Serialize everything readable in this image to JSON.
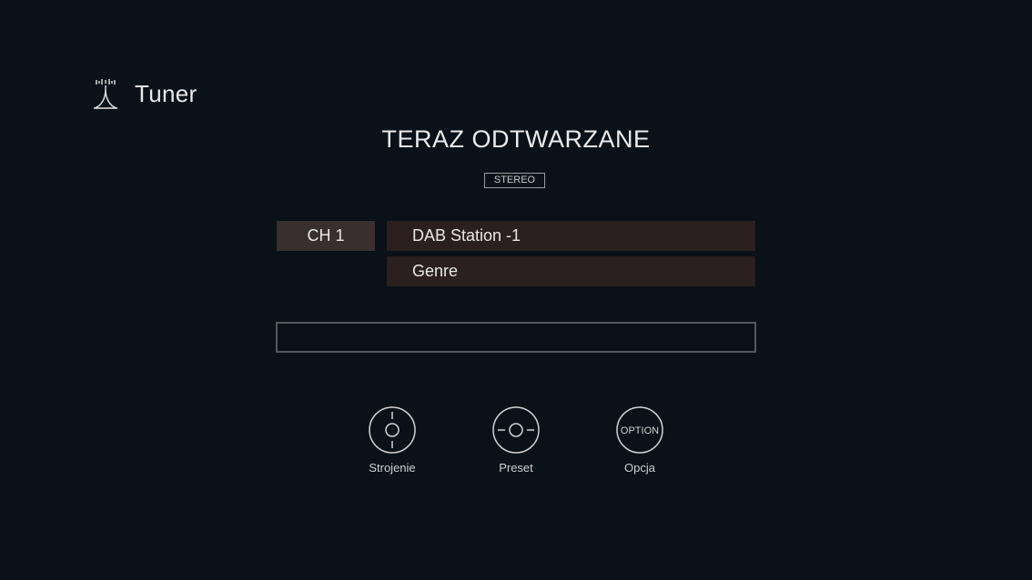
{
  "header": {
    "icon": "antenna-icon",
    "title": "Tuner"
  },
  "now_playing": {
    "title": "TERAZ ODTWARZANE",
    "mode_badge": "STEREO"
  },
  "station": {
    "channel": "CH 1",
    "name": "DAB Station -1",
    "genre": "Genre"
  },
  "text_info": "",
  "controls": [
    {
      "icon": "tuning-dial-icon",
      "label": "Strojenie"
    },
    {
      "icon": "preset-dial-icon",
      "label": "Preset"
    },
    {
      "icon": "option-button-icon",
      "label": "Opcja",
      "icon_text": "OPTION"
    }
  ],
  "colors": {
    "background": "#0a1118",
    "channel_bg": "#3a2f2f",
    "field_bg": "#2b1f1f"
  }
}
